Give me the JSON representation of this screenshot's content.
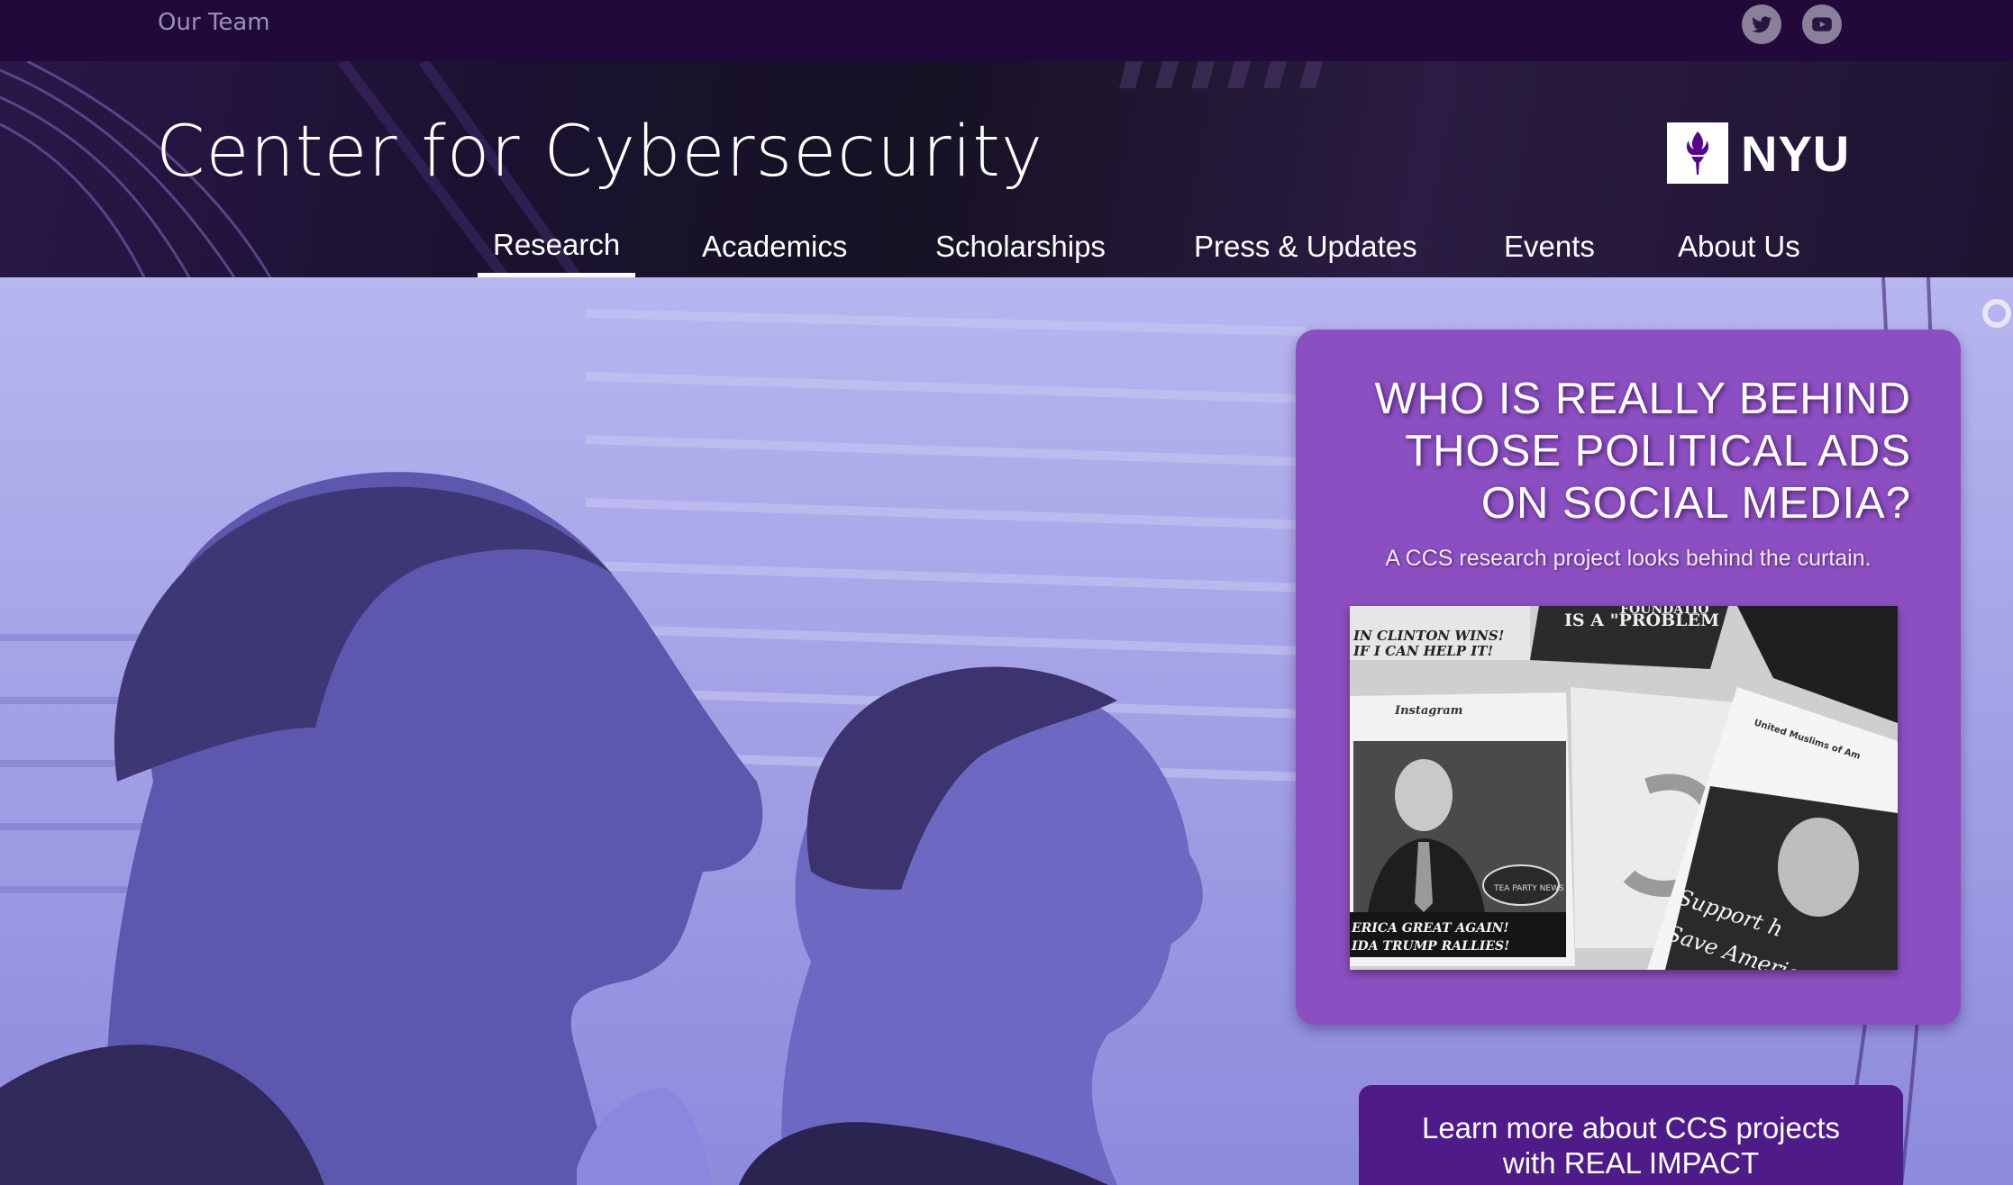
{
  "topbar": {
    "team_link": "Our Team",
    "social": [
      {
        "name": "twitter-icon"
      },
      {
        "name": "youtube-icon"
      }
    ]
  },
  "header": {
    "title": "Center for Cybersecurity",
    "logo_text": "NYU",
    "nav": [
      {
        "label": "Research",
        "active": true
      },
      {
        "label": "Academics"
      },
      {
        "label": "Scholarships"
      },
      {
        "label": "Press & Updates"
      },
      {
        "label": "Events"
      },
      {
        "label": "About Us"
      }
    ]
  },
  "hero": {
    "card": {
      "title_line1": "WHO IS REALLY BEHIND",
      "title_line2": "THOSE POLITICAL ADS",
      "title_line3": "ON SOCIAL MEDIA?",
      "subtitle": "A CCS research project looks behind the curtain.",
      "image_texts": {
        "a": "IN CLINTON WINS!",
        "b": "IF I CAN HELP IT!",
        "c": "IS A \"PROBLEM",
        "d": "FOUNDATIO",
        "e": "Instagram",
        "f": "ERICA GREAT AGAIN!",
        "g": "IDA TRUMP RALLIES!",
        "h": "United Muslims of Am",
        "i": "Support h",
        "j": "Save America",
        "k": "TEA PARTY NEWS"
      }
    },
    "cta": {
      "line1": "Learn more about CCS projects",
      "line2": "with REAL IMPACT"
    }
  },
  "colors": {
    "topbar": "#210a3b",
    "card": "#8c4fc1",
    "cta": "#4e1b88",
    "hero_tint": "#8f8fdf"
  }
}
